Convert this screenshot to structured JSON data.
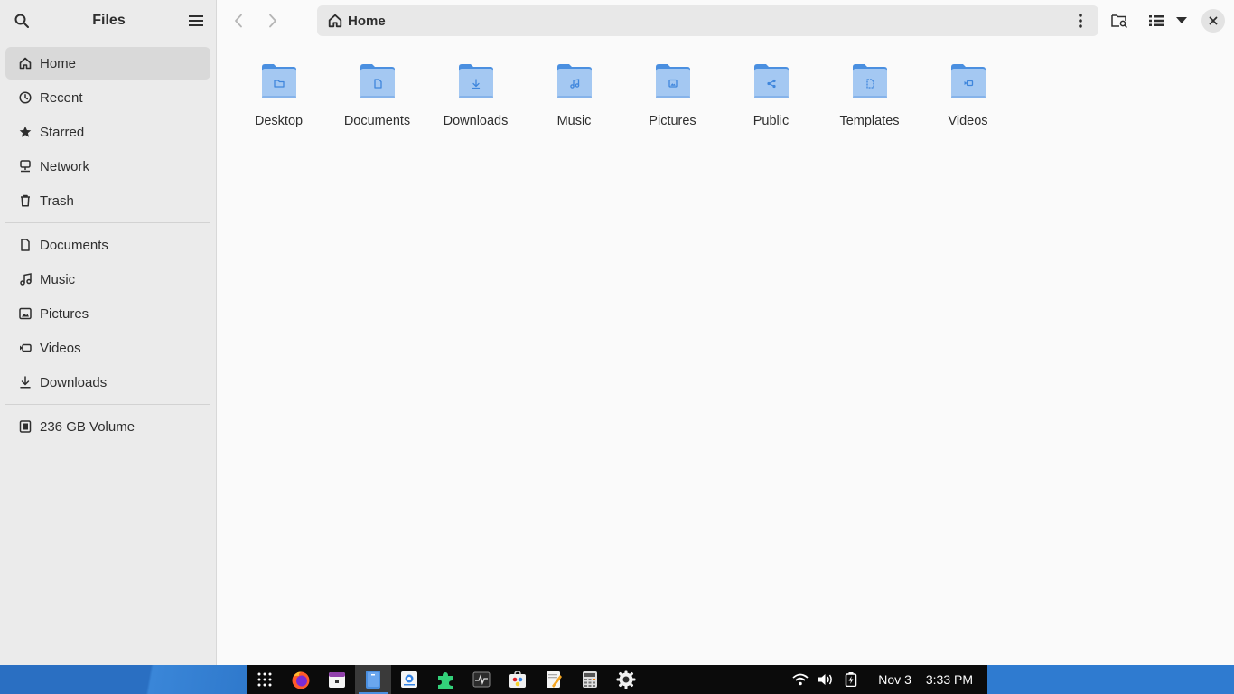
{
  "sidebar": {
    "title": "Files",
    "places": [
      {
        "label": "Home",
        "icon": "home-icon",
        "active": true
      },
      {
        "label": "Recent",
        "icon": "recent-icon"
      },
      {
        "label": "Starred",
        "icon": "star-icon"
      },
      {
        "label": "Network",
        "icon": "network-icon"
      },
      {
        "label": "Trash",
        "icon": "trash-icon"
      }
    ],
    "bookmarks": [
      {
        "label": "Documents",
        "icon": "document-icon"
      },
      {
        "label": "Music",
        "icon": "music-icon"
      },
      {
        "label": "Pictures",
        "icon": "pictures-icon"
      },
      {
        "label": "Videos",
        "icon": "videos-icon"
      },
      {
        "label": "Downloads",
        "icon": "download-icon"
      }
    ],
    "devices": [
      {
        "label": "236 GB Volume",
        "icon": "drive-icon"
      }
    ]
  },
  "header": {
    "path_label": "Home"
  },
  "folders": [
    {
      "label": "Desktop",
      "emblem": "folder"
    },
    {
      "label": "Documents",
      "emblem": "document"
    },
    {
      "label": "Downloads",
      "emblem": "download"
    },
    {
      "label": "Music",
      "emblem": "music"
    },
    {
      "label": "Pictures",
      "emblem": "picture"
    },
    {
      "label": "Public",
      "emblem": "share"
    },
    {
      "label": "Templates",
      "emblem": "template"
    },
    {
      "label": "Videos",
      "emblem": "video"
    }
  ],
  "taskbar": {
    "apps": [
      "app-grid-icon",
      "firefox-icon",
      "calendar-icon",
      "files-icon",
      "text-viewer-icon",
      "extensions-icon",
      "system-monitor-icon",
      "software-icon",
      "text-editor-icon",
      "calculator-icon",
      "settings-icon"
    ],
    "date": "Nov 3",
    "time": "3:33 PM"
  },
  "colors": {
    "accent": "#3584e4",
    "folder_body": "#a4c8f2",
    "folder_tab": "#4a8fe0",
    "sidebar_bg": "#ebebeb",
    "taskbar_bg": "#0b0b0b"
  }
}
